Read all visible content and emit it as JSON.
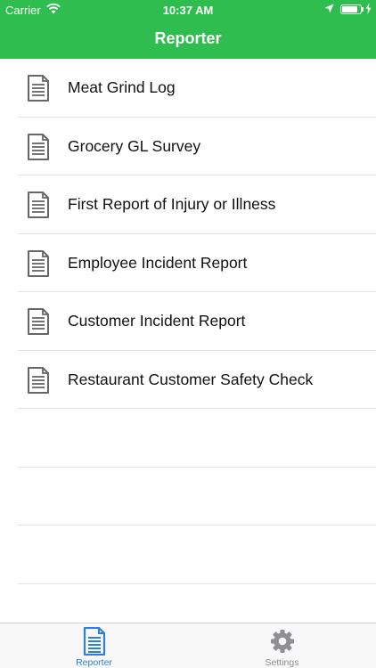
{
  "status_bar": {
    "carrier": "Carrier",
    "time": "10:37 AM",
    "battery_level": 0.85
  },
  "nav": {
    "title": "Reporter"
  },
  "reports": [
    {
      "label": "Meat Grind Log",
      "icon": "document-icon"
    },
    {
      "label": "Grocery GL Survey",
      "icon": "document-icon"
    },
    {
      "label": "First Report of Injury or Illness",
      "icon": "document-icon"
    },
    {
      "label": "Employee Incident Report",
      "icon": "document-icon"
    },
    {
      "label": "Customer Incident Report",
      "icon": "document-icon"
    },
    {
      "label": "Restaurant Customer Safety Check",
      "icon": "document-icon"
    }
  ],
  "tabs": {
    "reporter": {
      "label": "Reporter",
      "icon": "document-icon",
      "active": true
    },
    "settings": {
      "label": "Settings",
      "icon": "gear-icon",
      "active": false
    }
  },
  "colors": {
    "brand": "#2ebd4e",
    "tab_active": "#2f7fd8",
    "tab_inactive": "#8e8e93",
    "icon_gray": "#666666"
  }
}
